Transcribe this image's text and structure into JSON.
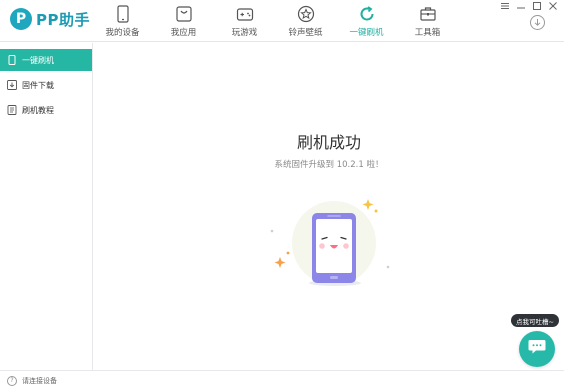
{
  "app": {
    "logo_mark": "P",
    "name": "PP助手"
  },
  "nav": {
    "items": [
      {
        "label": "我的设备",
        "icon": "phone-icon"
      },
      {
        "label": "我应用",
        "icon": "bag-icon"
      },
      {
        "label": "玩游戏",
        "icon": "gamepad-icon"
      },
      {
        "label": "铃声壁纸",
        "icon": "star-icon"
      },
      {
        "label": "一键刷机",
        "icon": "refresh-icon",
        "active": true
      },
      {
        "label": "工具箱",
        "icon": "toolbox-icon"
      }
    ],
    "active_color": "#1fb0a1"
  },
  "sidebar": {
    "items": [
      {
        "label": "一键刷机",
        "icon": "phone-icon",
        "active": true
      },
      {
        "label": "固件下载",
        "icon": "download-icon"
      },
      {
        "label": "刷机教程",
        "icon": "book-icon"
      }
    ],
    "active_color": "#25b7a3"
  },
  "main": {
    "title": "刷机成功",
    "subtitle": "系统固件升级到 10.2.1 啦！"
  },
  "status": {
    "text": "请连接设备"
  },
  "chat": {
    "tip": "点我可吐槽~"
  },
  "colors": {
    "brand": "#1fa7c0",
    "accent": "#25b7a3",
    "phone_purple": "#8b86e8"
  }
}
